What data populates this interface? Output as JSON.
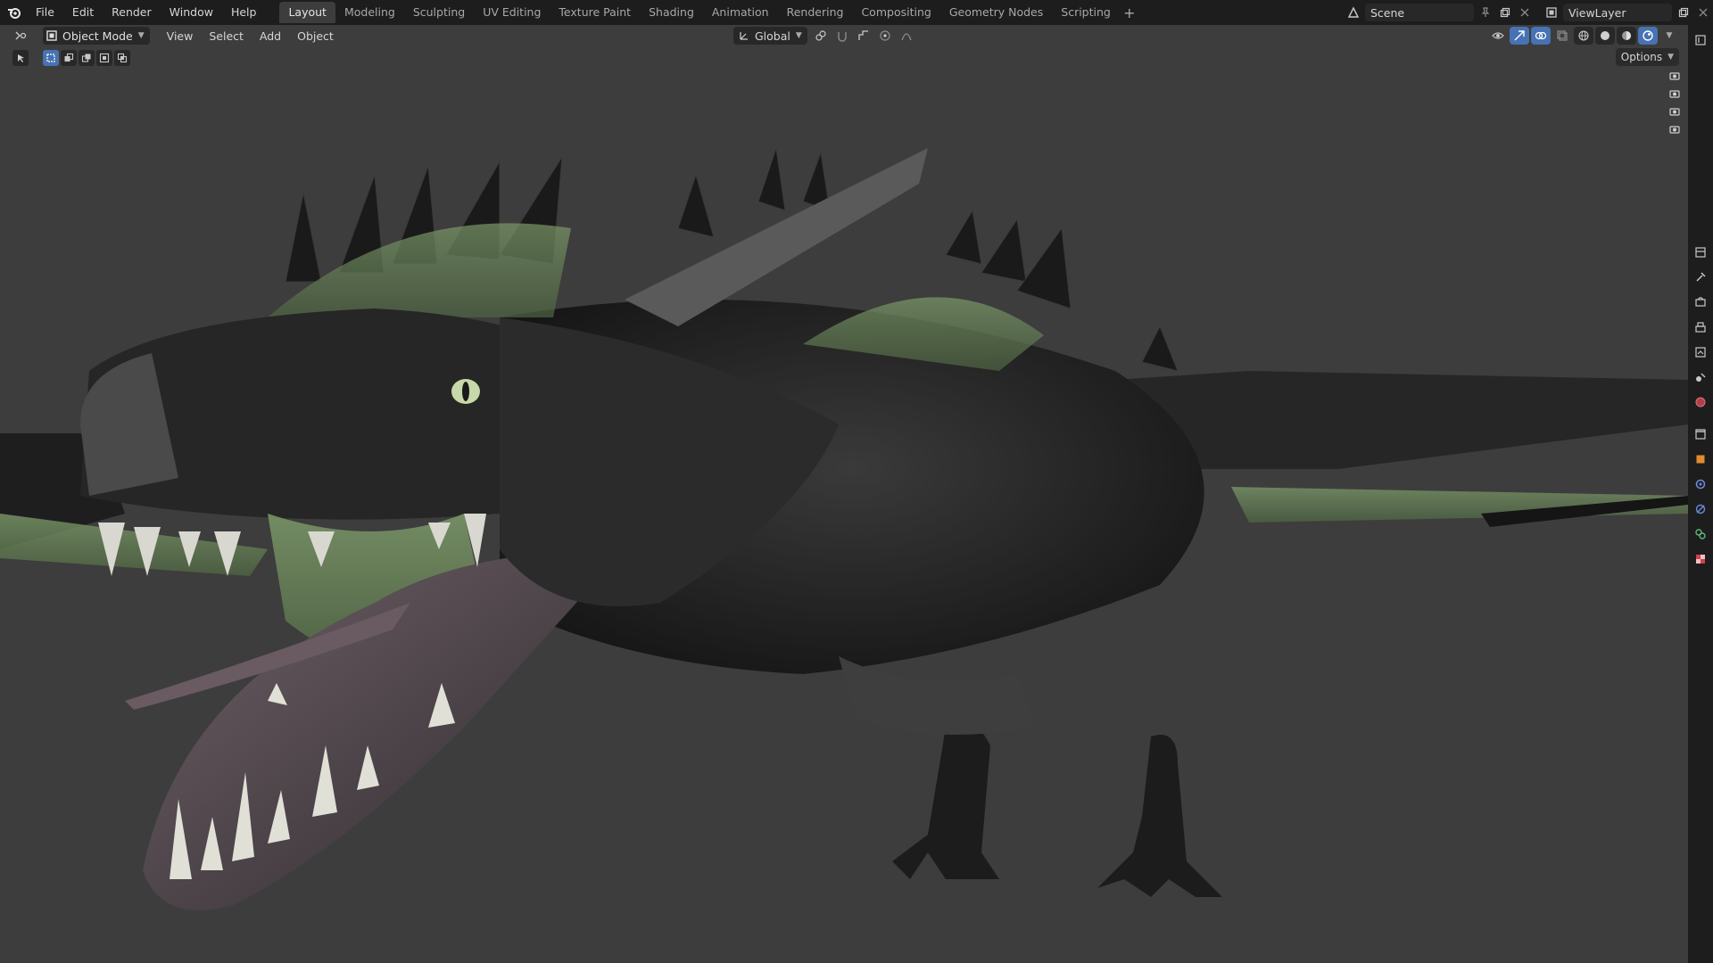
{
  "topbar": {
    "menus": [
      "File",
      "Edit",
      "Render",
      "Window",
      "Help"
    ],
    "workspaces": [
      "Layout",
      "Modeling",
      "Sculpting",
      "UV Editing",
      "Texture Paint",
      "Shading",
      "Animation",
      "Rendering",
      "Compositing",
      "Geometry Nodes",
      "Scripting"
    ],
    "active_workspace": "Layout",
    "add_workspace": "+",
    "scene_name": "Scene",
    "view_layer_name": "ViewLayer"
  },
  "viewport_header": {
    "mode": "Object Mode",
    "menus": [
      "View",
      "Select",
      "Add",
      "Object"
    ],
    "transform_orientation": "Global",
    "options_label": "Options"
  },
  "colors": {
    "accent": "#4772b3",
    "topbar_bg": "#1d1d1d",
    "viewport_bg": "#3d3d3d"
  }
}
